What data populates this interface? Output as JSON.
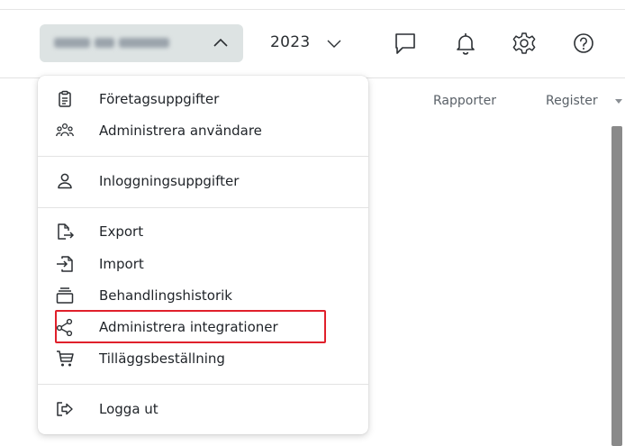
{
  "header": {
    "company_selector": {
      "redacted": true,
      "expanded": true,
      "icon": "chevron-up-icon"
    },
    "year": "2023",
    "year_icon": "chevron-down-icon",
    "icons": [
      "chat-icon",
      "bell-icon",
      "gear-icon",
      "help-icon"
    ]
  },
  "nav": {
    "reports": "Rapporter",
    "register": "Register"
  },
  "menu": {
    "items": [
      {
        "label": "Företagsuppgifter",
        "icon": "clipboard-icon"
      },
      {
        "label": "Administrera användare",
        "icon": "users-icon"
      },
      {
        "label": "Inloggningsuppgifter",
        "icon": "user-icon"
      },
      {
        "label": "Export",
        "icon": "export-icon"
      },
      {
        "label": "Import",
        "icon": "import-icon"
      },
      {
        "label": "Behandlingshistorik",
        "icon": "history-icon"
      },
      {
        "label": "Administrera integrationer",
        "icon": "share-nodes-icon",
        "highlighted": true
      },
      {
        "label": "Tilläggsbeställning",
        "icon": "cart-icon"
      },
      {
        "label": "Logga ut",
        "icon": "logout-icon"
      }
    ]
  },
  "colors": {
    "highlight_border": "#e0202b",
    "pill_background": "#dde3e3"
  }
}
